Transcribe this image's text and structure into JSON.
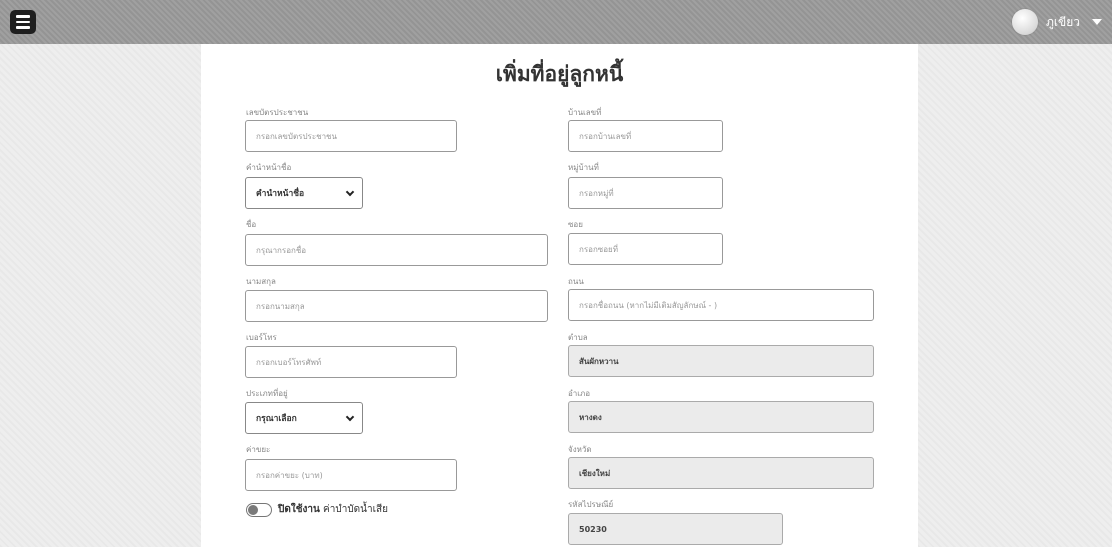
{
  "header": {
    "user_name": "ภูเขียว"
  },
  "page": {
    "title": "เพิ่มที่อยู่ลูกหนี้"
  },
  "left_form": {
    "id_card": {
      "label": "เลขบัตรประชาชน",
      "placeholder": "กรอกเลขบัตรประชาชน"
    },
    "prefix": {
      "label": "คำนำหน้าชื่อ",
      "value": "คำนำหน้าชื่อ"
    },
    "first_name": {
      "label": "ชื่อ",
      "placeholder": "กรุณากรอกชื่อ"
    },
    "last_name": {
      "label": "นามสกุล",
      "placeholder": "กรอกนามสกุล"
    },
    "phone": {
      "label": "เบอร์โทร",
      "placeholder": "กรอกเบอร์โทรศัพท์"
    },
    "resident_type": {
      "label": "ประเภทที่อยู่",
      "value": "กรุณาเลือก"
    },
    "garbage_fee": {
      "label": "ค่าขยะ",
      "placeholder": "กรอกค่าขยะ (บาท)"
    },
    "wastewater_toggle": {
      "state_label": "ปิดใช้งาน",
      "label": "ค่าบำบัดน้ำเสีย"
    }
  },
  "right_form": {
    "house_no": {
      "label": "บ้านเลขที่",
      "placeholder": "กรอกบ้านเลขที่"
    },
    "village_no": {
      "label": "หมู่บ้านที่",
      "placeholder": "กรอกหมู่ที่"
    },
    "soi": {
      "label": "ซอย",
      "placeholder": "กรอกซอยที่"
    },
    "road": {
      "label": "ถนน",
      "placeholder": "กรอกชื่อถนน (หากไม่มีเติมสัญลักษณ์ - )"
    },
    "subdistrict": {
      "label": "ตำบล",
      "value": "สันผักหวาน"
    },
    "district": {
      "label": "อำเภอ",
      "value": "หางดง"
    },
    "province": {
      "label": "จังหวัด",
      "value": "เชียงใหม่"
    },
    "postcode": {
      "label": "รหัสไปรษณีย์",
      "value": "50230"
    }
  }
}
